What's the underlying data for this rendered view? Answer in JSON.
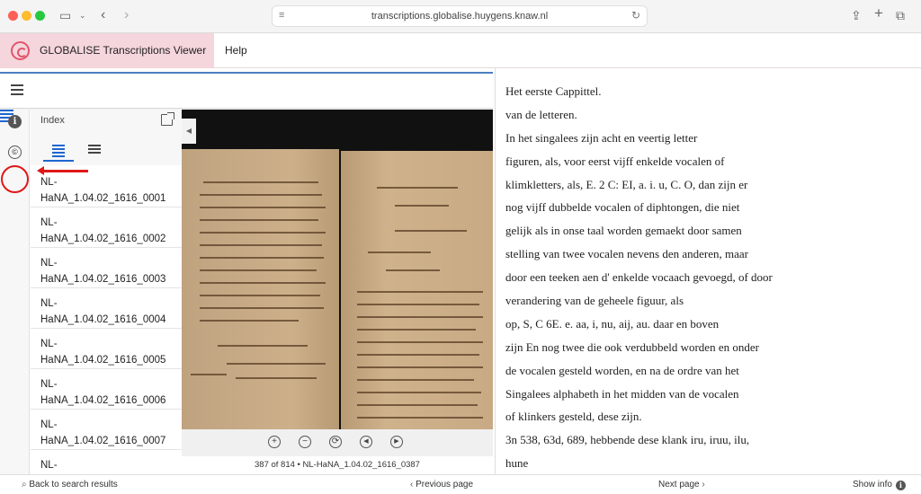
{
  "browser": {
    "url": "transcriptions.globalise.huygens.knaw.nl",
    "icons": [
      "sidebar-icon",
      "back-icon",
      "forward-icon",
      "reload-icon",
      "share-icon",
      "new-tab-icon",
      "tabs-icon"
    ]
  },
  "app": {
    "title": "GLOBALISE Transcriptions Viewer",
    "help_label": "Help",
    "brand_color": "#e2546d",
    "brand_bg": "#f5d6dc"
  },
  "rail": {
    "info_glyph": "i",
    "copyright_glyph": "©"
  },
  "index": {
    "title": "Index",
    "items": [
      "NL-HaNA_1.04.02_1616_0001",
      "NL-HaNA_1.04.02_1616_0002",
      "NL-HaNA_1.04.02_1616_0003",
      "NL-HaNA_1.04.02_1616_0004",
      "NL-HaNA_1.04.02_1616_0005",
      "NL-HaNA_1.04.02_1616_0006",
      "NL-HaNA_1.04.02_1616_0007",
      "NL-"
    ]
  },
  "viewer": {
    "handle_glyph": "◀",
    "caption": "387 of 814 • NL-HaNA_1.04.02_1616_0387",
    "controls": [
      "+",
      "−",
      "⟳",
      "◀",
      "▶"
    ]
  },
  "transcription": {
    "lines": [
      "Het eerste Cappittel.",
      "van de letteren.",
      "In het singalees zijn acht en veertig letter",
      "figuren, als, voor eerst vijff enkelde vocalen of",
      "klimkletters, als, E. 2 C: EI, a. i. u, C. O, dan zijn er",
      "nog vijff dubbelde vocalen of diphtongen, die niet",
      "gelijk als in onse taal worden gemaekt door samen",
      "stelling van twee vocalen nevens den anderen, maar",
      "door een teeken aen d' enkelde vocaach gevoegd, of door",
      "verandering van de geheele figuur, als",
      "op, S, C 6E. e. aa, i, nu, aij, au. daar en boven",
      "zijn En nog twee die ook verdubbeld worden en onder",
      "de vocalen gesteld worden, en na de ordre van het",
      "Singalees alphabeth in het midden van de vocalen",
      "of klinkers gesteld, dese zijn.",
      "3n 538, 63d, 689, hebbende dese klank iru, iruu, ilu,",
      "hune"
    ]
  },
  "footer": {
    "back": "Back to search results",
    "previous": "Previous page",
    "next": "Next page",
    "show_info": "Show info"
  },
  "colors": {
    "accent_blue": "#1f66d1",
    "annotation_red": "#e01818"
  }
}
